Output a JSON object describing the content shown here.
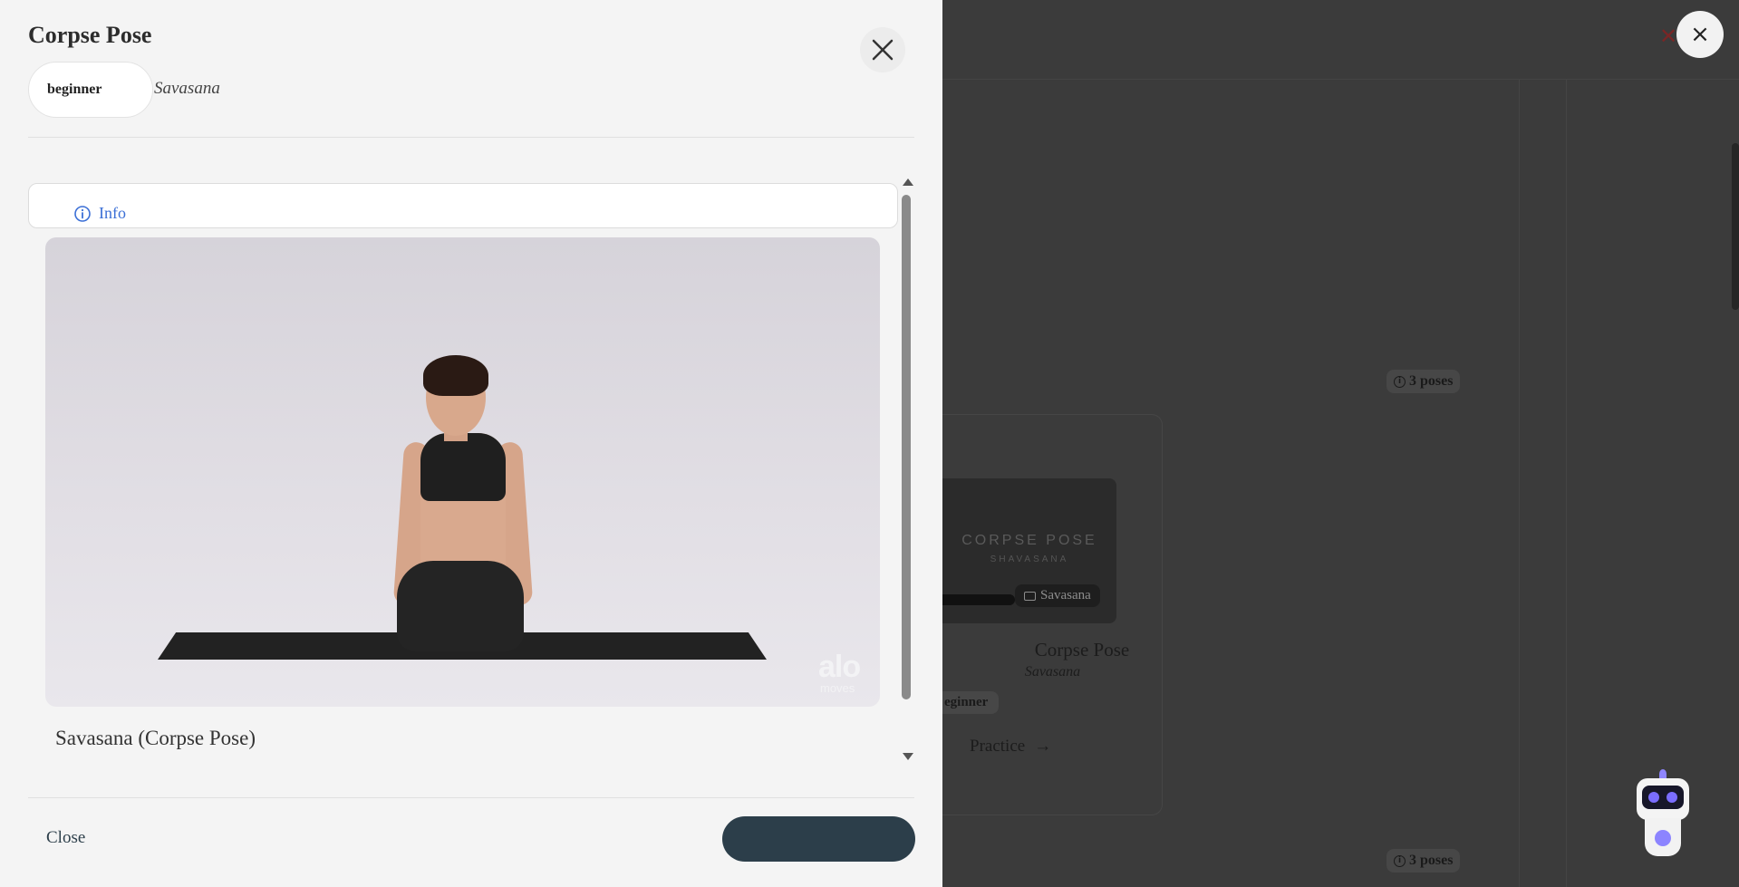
{
  "background": {
    "pose_count_top": "3 poses",
    "pose_count_bottom": "3 poses",
    "card": {
      "thumb_title": "CORPSE POSE",
      "thumb_subtitle": "SHAVASANA",
      "thumb_chip": "Savasana",
      "title": "Corpse Pose",
      "sanskrit": "Savasana",
      "badge": "eginner",
      "practice_label": "Practice",
      "practice_arrow": "→"
    },
    "close_icon": "×",
    "red_x": "✕"
  },
  "modal": {
    "title": "Corpse Pose",
    "badge": "beginner",
    "sanskrit": "Savasana",
    "info_tab_label": "Info",
    "video_brand": "alo",
    "video_brand_sub": "moves",
    "video_caption": "Savasana (Corpse Pose)",
    "close_link": "Close",
    "primary_button": ""
  },
  "colors": {
    "accent_blue": "#3b6fd6",
    "primary_dark": "#2c3e4a",
    "robot_purple": "#8c84ff"
  }
}
